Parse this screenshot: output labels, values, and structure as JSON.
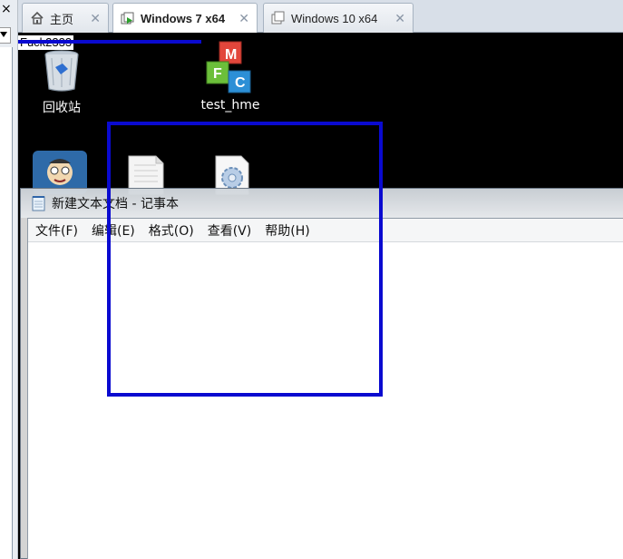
{
  "colors": {
    "annotation_blue": "#0a0ad0",
    "desktop_bg": "#000000",
    "tab_bar_bg": "#d8dfe8"
  },
  "left_strip": {
    "close_glyph": "×"
  },
  "tabs": [
    {
      "label": "主页",
      "icon": "home-icon",
      "close": "✕"
    },
    {
      "label": "Windows 7 x64",
      "icon": "vm-running-icon",
      "close": "✕"
    },
    {
      "label": "Windows 10 x64",
      "icon": "vm-icon",
      "close": "✕"
    }
  ],
  "desktop": {
    "overlay_text": "Fuck2333",
    "icons": [
      {
        "label": "回收站",
        "icon": "recycle-bin-icon"
      },
      {
        "label": "test_hme",
        "icon": "mfc-app-icon"
      },
      {
        "label": "",
        "icon": "user-avatar-icon"
      },
      {
        "label": "",
        "icon": "text-document-icon"
      },
      {
        "label": "",
        "icon": "settings-file-icon"
      }
    ]
  },
  "notepad": {
    "title": "新建文本文档 - 记事本",
    "menu": [
      "文件(F)",
      "编辑(E)",
      "格式(O)",
      "查看(V)",
      "帮助(H)"
    ],
    "content": ""
  }
}
